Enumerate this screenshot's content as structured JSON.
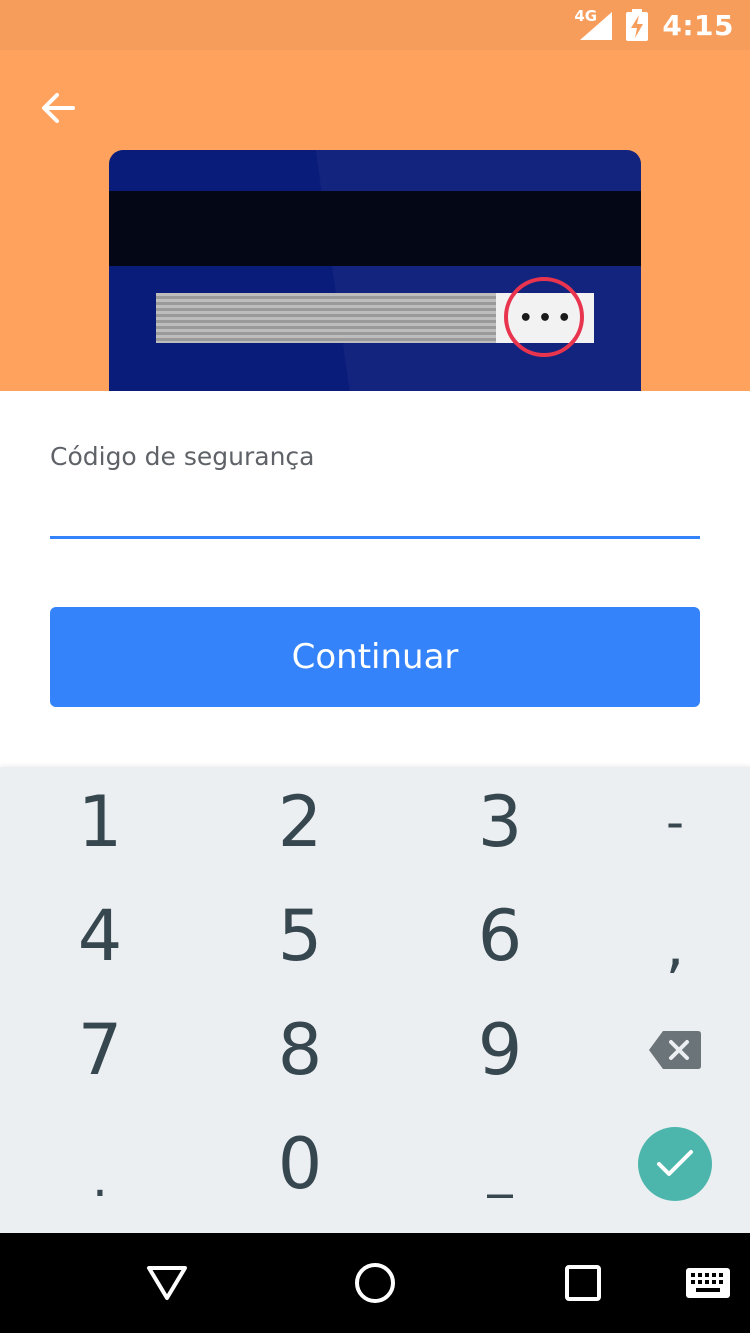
{
  "status_bar": {
    "network": "4G",
    "time": "4:15",
    "background_color": "#F79D5C"
  },
  "header": {
    "background_color": "#FFA25E",
    "back_icon": "arrow-left-icon",
    "card": {
      "body_color": "#0A1C7A",
      "stripe_color": "#040816",
      "cvv_dots": "•••",
      "highlight_color": "#E8344E"
    }
  },
  "form": {
    "field_label": "Código de segurança",
    "field_value": "",
    "accent_color": "#3483FA",
    "continue_label": "Continuar"
  },
  "keyboard": {
    "rows": [
      [
        "1",
        "2",
        "3",
        "-"
      ],
      [
        "4",
        "5",
        "6",
        ","
      ],
      [
        "7",
        "8",
        "9",
        "backspace-icon"
      ],
      [
        ".",
        "0",
        "_",
        "check-icon"
      ]
    ],
    "enter_color": "#4DB6AC"
  },
  "nav_bar": {
    "buttons": [
      "back-triangle-icon",
      "home-circle-icon",
      "recents-square-icon",
      "keyboard-icon"
    ]
  }
}
